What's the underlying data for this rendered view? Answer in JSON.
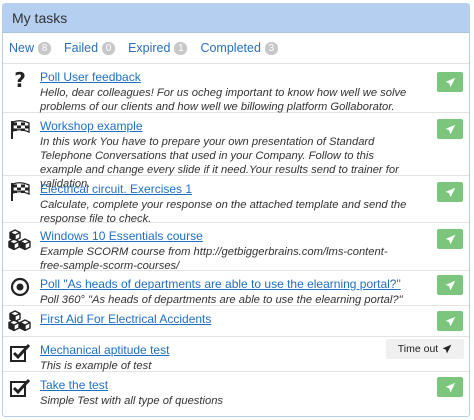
{
  "header": {
    "title": "My tasks"
  },
  "tabs": [
    {
      "label": "New",
      "count": "8"
    },
    {
      "label": "Failed",
      "count": "0"
    },
    {
      "label": "Expired",
      "count": "1"
    },
    {
      "label": "Completed",
      "count": "3"
    }
  ],
  "tasks": [
    {
      "icon": "question-icon",
      "title": "Poll User feedback",
      "description": "Hello, dear colleagues! For us ocheg important to know how well we solve problems of our clients and how well we billowing platform Gollaborator.",
      "action": "start"
    },
    {
      "icon": "checkered-flag-icon",
      "title": "Workshop example",
      "description": "In this work You have to prepare your own presentation of Standard Telephone Conversations that used in your Company. Follow to this example and change every slide if it need.Your results send to trainer for validation.",
      "action": "start"
    },
    {
      "icon": "checkered-flag-icon",
      "title": "Electrical circuit. Exercises 1",
      "description": "Calculate, complete your response on the attached template and send the response file to check.",
      "action": "start"
    },
    {
      "icon": "cubes-icon",
      "title": "Windows 10 Essentials course",
      "description": "Example SCORM course from http://getbiggerbrains.com/lms-content-free-sample-scorm-courses/",
      "action": "start"
    },
    {
      "icon": "bullseye-icon",
      "title": "Poll \"As heads of departments are able to use the elearning portal?\"",
      "description": "Poll 360° \"As heads of departments are able to use the elearning portal?\"",
      "action": "start"
    },
    {
      "icon": "cubes-icon",
      "title": "First Aid For Electrical Accidents",
      "description": "",
      "action": "start"
    },
    {
      "icon": "checkbox-icon",
      "title": "Mechanical aptitude test",
      "description": "This is example of test",
      "action": "timeout",
      "action_label": "Time out"
    },
    {
      "icon": "checkbox-icon",
      "title": "Take the test",
      "description": "Simple Test with all type of questions",
      "action": "start"
    }
  ],
  "colors": {
    "header_bg": "#b4cff0",
    "link": "#1f6fc4",
    "go_button": "#7bc67c",
    "badge": "#c8c8c8"
  }
}
